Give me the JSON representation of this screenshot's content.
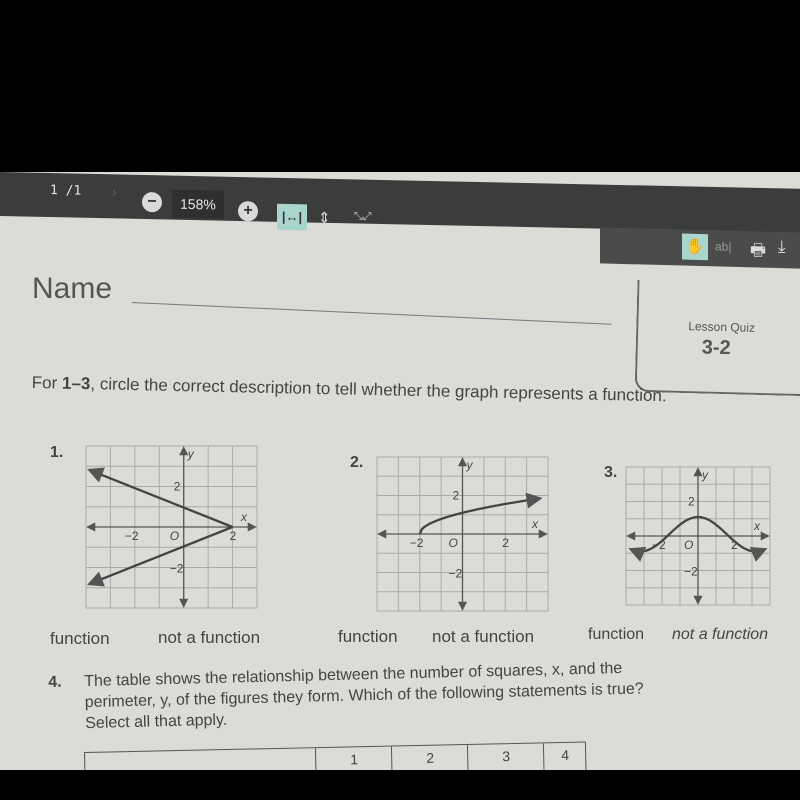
{
  "toolbar": {
    "page_indicator": "1 /1",
    "next_page_glyph": "›",
    "zoom_out_glyph": "−",
    "zoom_level": "158%",
    "zoom_in_glyph": "+",
    "fit_width_glyph": "|↔|",
    "fit_height_glyph": "⇕",
    "fullscreen_glyph": "⤡⤢",
    "hand_glyph": "✋",
    "text_select_label": "ab|",
    "print_glyph": "🖶",
    "download_glyph": "⤓",
    "accent_color": "#a9d6cc"
  },
  "document": {
    "name_label": "Name",
    "quiz_label": "Lesson Quiz",
    "quiz_number": "3-2",
    "instruction_prefix": "For ",
    "instruction_bold": "1–3",
    "instruction_rest": ", circle the correct description to tell whether the graph represents a function.",
    "questions": [
      {
        "number": "1.",
        "choices": [
          "function",
          "not a function"
        ]
      },
      {
        "number": "2.",
        "choices": [
          "function",
          "not a function"
        ]
      },
      {
        "number": "3.",
        "choices": [
          "function",
          "not a function"
        ]
      }
    ],
    "axis_labels": {
      "x": "x",
      "y": "y",
      "origin": "O",
      "neg2": "−2",
      "pos2": "2"
    },
    "q4": {
      "number": "4.",
      "text": "The table shows the relationship between the number of squares, x, and the perimeter, y, of the figures they form. Which of the following statements is true? Select all that apply."
    },
    "table_headers": [
      "",
      "1",
      "2",
      "3",
      "4"
    ]
  }
}
